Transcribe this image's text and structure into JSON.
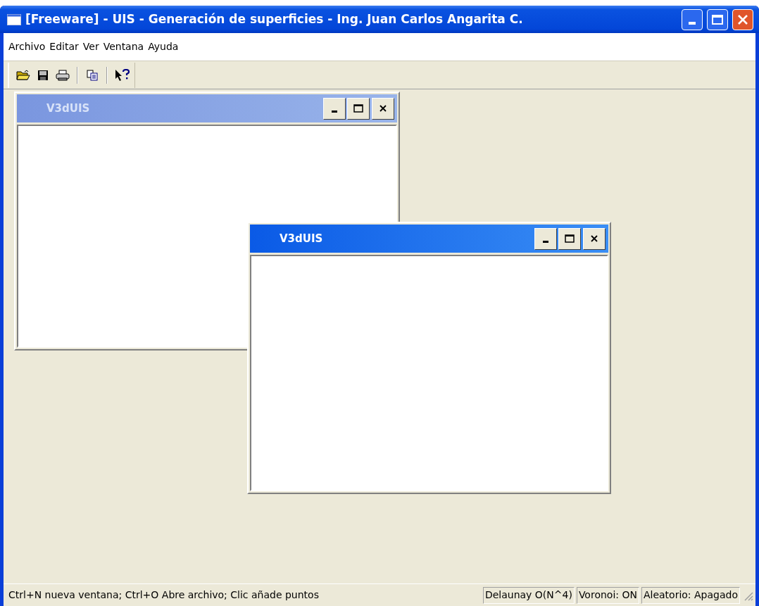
{
  "window": {
    "title": "[Freeware] - UIS - Generación de superficies - Ing. Juan Carlos Angarita C."
  },
  "menu": [
    {
      "label": "Archivo"
    },
    {
      "label": "Editar"
    },
    {
      "label": "Ver"
    },
    {
      "label": "Ventana"
    },
    {
      "label": "Ayuda"
    }
  ],
  "toolbar": [
    {
      "kind": "open"
    },
    {
      "kind": "save"
    },
    {
      "kind": "print"
    },
    {
      "kind": "separator"
    },
    {
      "kind": "copy"
    },
    {
      "kind": "separator"
    },
    {
      "kind": "help"
    }
  ],
  "child_windows": [
    {
      "title": "V3dUIS",
      "active": false
    },
    {
      "title": "V3dUIS",
      "active": true
    }
  ],
  "status_bar": {
    "message": "Ctrl+N nueva ventana; Ctrl+O Abre archivo; Clic añade puntos",
    "panels": [
      "Delaunay O(N^4)",
      "Voronoi: ON",
      "Aleatorio: Apagado"
    ]
  }
}
